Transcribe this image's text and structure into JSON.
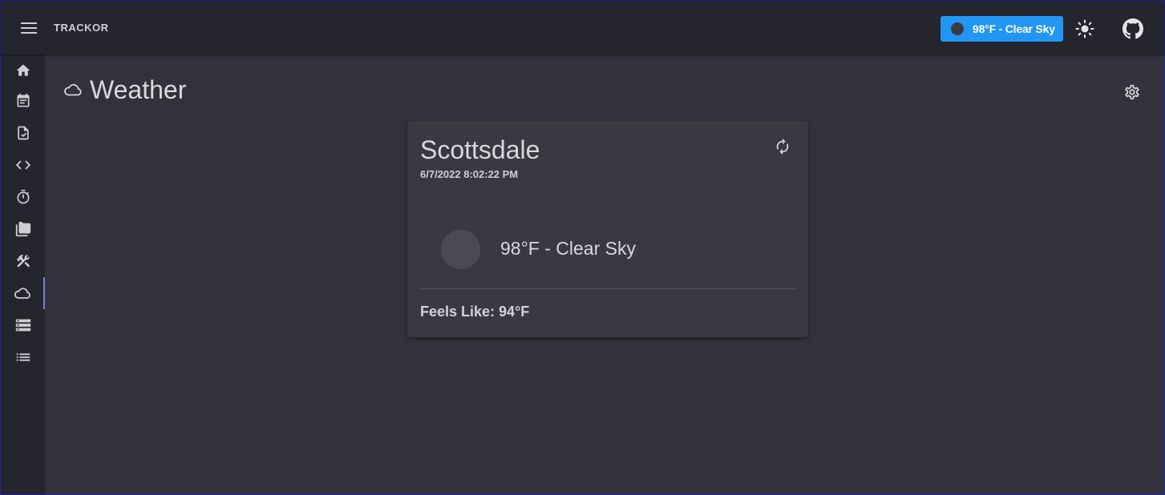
{
  "app": {
    "title": "TRACKOR",
    "weather_chip": "98°F - Clear Sky"
  },
  "icons": {
    "menu": "menu-icon",
    "theme": "brightness-icon",
    "github": "github-icon",
    "settings": "gear-icon",
    "refresh": "refresh-icon",
    "page": "cloud-icon"
  },
  "sidebar": {
    "items": [
      {
        "name": "home",
        "icon": "home-icon"
      },
      {
        "name": "calendar",
        "icon": "calendar-icon"
      },
      {
        "name": "tasks",
        "icon": "file-check-icon"
      },
      {
        "name": "code",
        "icon": "code-icon"
      },
      {
        "name": "timer",
        "icon": "timer-icon"
      },
      {
        "name": "folders",
        "icon": "folder-icon"
      },
      {
        "name": "tools",
        "icon": "tools-icon"
      },
      {
        "name": "weather",
        "icon": "cloud-icon",
        "active": true
      },
      {
        "name": "storage",
        "icon": "storage-icon"
      },
      {
        "name": "list",
        "icon": "list-icon"
      }
    ]
  },
  "page": {
    "title": "Weather"
  },
  "card": {
    "city": "Scottsdale",
    "timestamp": "6/7/2022 8:02:22 PM",
    "condition": "98°F - Clear Sky",
    "feels_like": "Feels Like: 94°F"
  },
  "colors": {
    "accent": "#2196f3",
    "active_indicator": "#7b7bd6",
    "background": "#32323c",
    "bar": "#25252d",
    "card": "#393942"
  }
}
